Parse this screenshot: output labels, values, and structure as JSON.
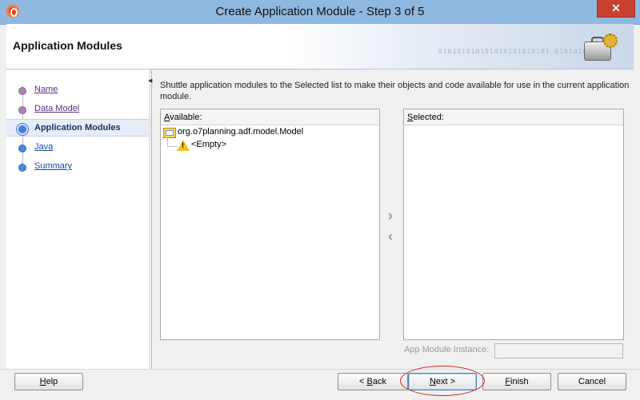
{
  "window": {
    "title": "Create Application Module - Step 3 of 5",
    "close_glyph": "✕"
  },
  "header": {
    "title": "Application Modules",
    "binary_text": "010101010101010101010101 0101010101"
  },
  "nav": {
    "items": [
      {
        "label": "Name",
        "state": "done"
      },
      {
        "label": "Data Model",
        "state": "done"
      },
      {
        "label": "Application Modules",
        "state": "active"
      },
      {
        "label": "Java",
        "state": "future"
      },
      {
        "label": "Summary",
        "state": "future"
      }
    ]
  },
  "main": {
    "instructions": "Shuttle application modules to the Selected list to make their objects and code available for use in the current application module.",
    "available": {
      "header_accel": "A",
      "header_rest": "vailable:",
      "tree": [
        {
          "label": "org.o7planning.adf.model.Model",
          "icon": "folder-icon"
        },
        {
          "label": "<Empty>",
          "icon": "warning-icon"
        }
      ]
    },
    "selected": {
      "header_accel": "S",
      "header_rest": "elected:"
    },
    "shuttle": {
      "move_right": "›",
      "move_left": "‹"
    },
    "instance": {
      "label": "App Module Instance:",
      "value": ""
    }
  },
  "footer": {
    "help": {
      "accel": "H",
      "rest": "elp"
    },
    "back": {
      "pre": "< ",
      "accel": "B",
      "rest": "ack"
    },
    "next": {
      "accel": "N",
      "rest": "ext >"
    },
    "finish": {
      "accel": "F",
      "rest": "inish"
    },
    "cancel": "Cancel"
  },
  "colors": {
    "accent": "#4a7ad8",
    "highlight_ring": "#d02020",
    "title_bar": "#8fb8e0"
  }
}
